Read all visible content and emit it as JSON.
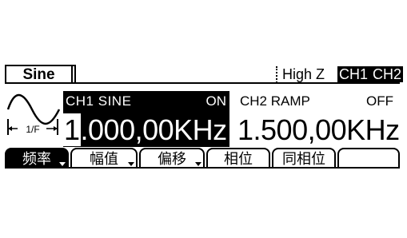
{
  "header": {
    "waveform_tab": "Sine",
    "impedance": "High Z",
    "ch1_indicator": "CH1",
    "ch2_indicator": "CH2"
  },
  "waveform_icon": {
    "icon": "sine-wave-icon",
    "period_label": "1/F"
  },
  "channel1": {
    "label": "CH1",
    "waveform": "SINE",
    "state": "ON",
    "frequency_cursor_digit": "1",
    "frequency_rest": ".000,00KHz"
  },
  "channel2": {
    "label": "CH2",
    "waveform": "RAMP",
    "state": "OFF",
    "frequency": "1.500,00KHz"
  },
  "softkeys": [
    {
      "label": "频率",
      "active": true,
      "has_arrow": true
    },
    {
      "label": "幅值",
      "active": false,
      "has_arrow": true
    },
    {
      "label": "偏移",
      "active": false,
      "has_arrow": true
    },
    {
      "label": "相位",
      "active": false,
      "has_arrow": false
    },
    {
      "label": "同相位",
      "active": false,
      "has_arrow": false
    },
    {
      "label": "",
      "active": false,
      "has_arrow": false
    }
  ]
}
